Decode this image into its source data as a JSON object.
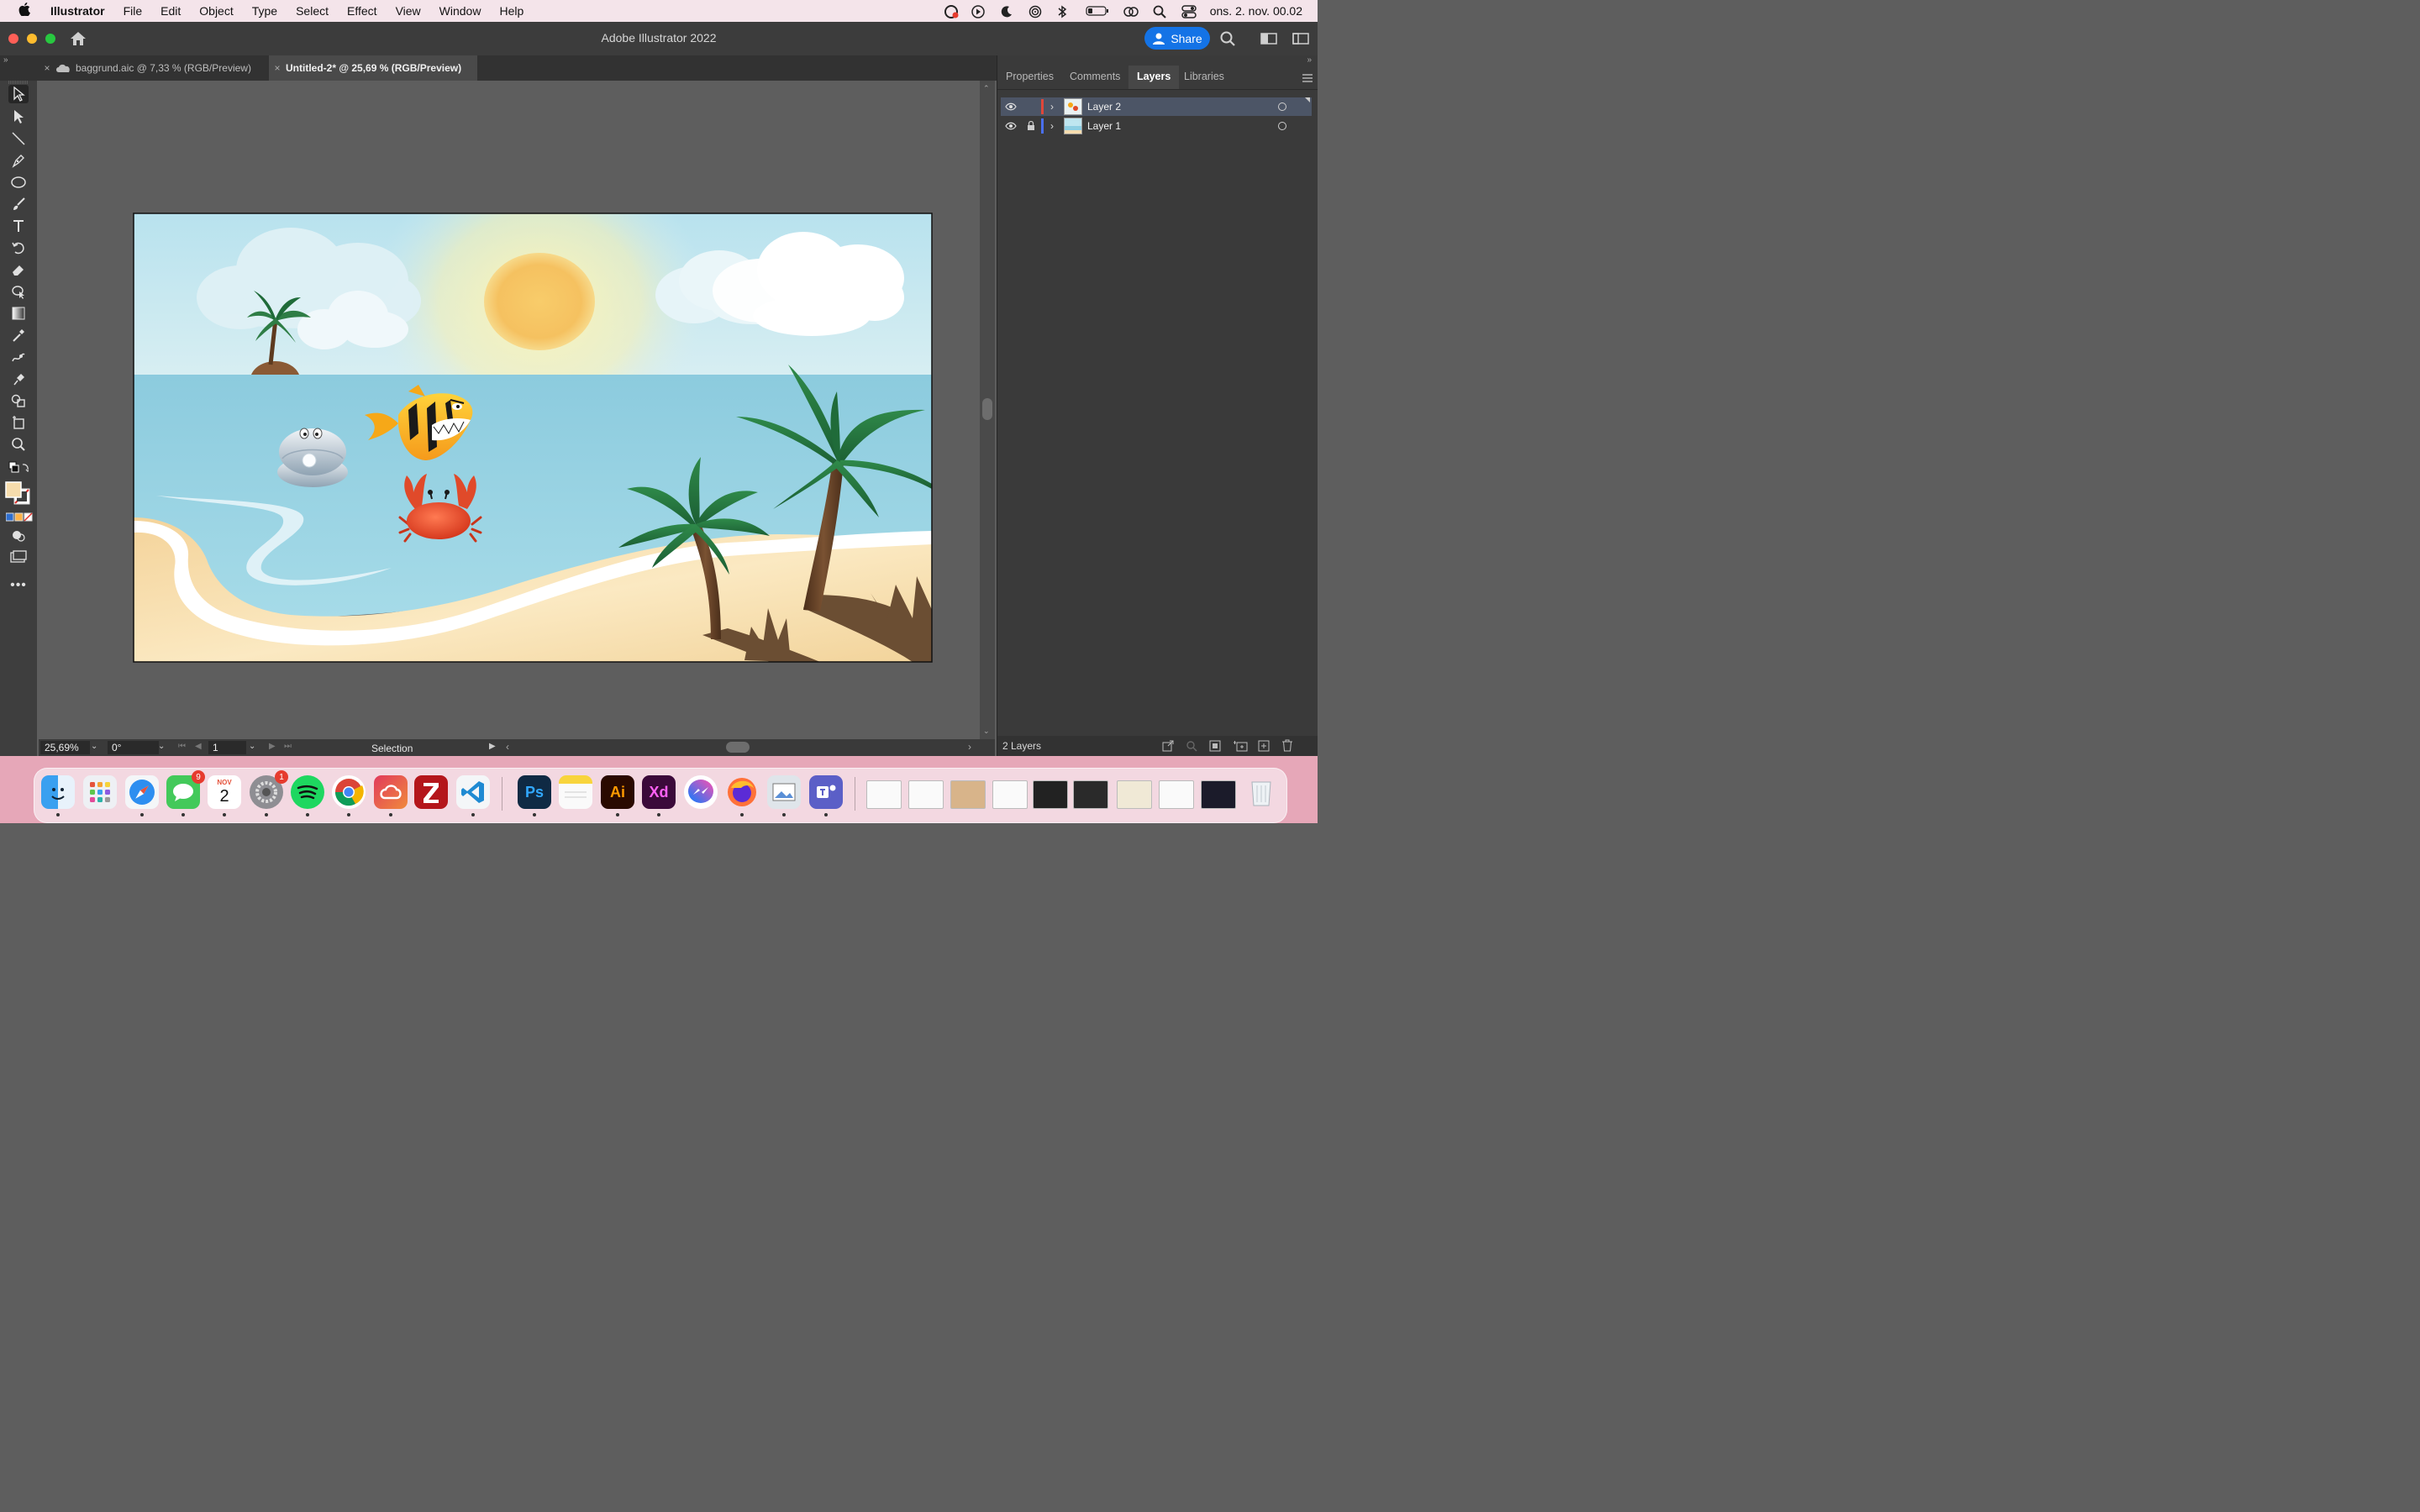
{
  "menubar": {
    "app": "Illustrator",
    "items": [
      "File",
      "Edit",
      "Object",
      "Type",
      "Select",
      "Effect",
      "View",
      "Window",
      "Help"
    ],
    "clock": "ons. 2. nov.  00.02"
  },
  "window": {
    "title": "Adobe Illustrator 2022",
    "share_label": "Share"
  },
  "tabs": [
    {
      "label": "baggrund.aic @ 7,33 % (RGB/Preview)",
      "active": false
    },
    {
      "label": "Untitled-2* @ 25,69 % (RGB/Preview)",
      "active": true
    }
  ],
  "statusbar": {
    "zoom": "25,69%",
    "rotation": "0°",
    "artboard": "1",
    "tool": "Selection"
  },
  "panel": {
    "tabs": [
      "Properties",
      "Comments",
      "Layers",
      "Libraries"
    ],
    "active_tab": "Layers",
    "layers": [
      {
        "name": "Layer 2",
        "color": "#e0473a",
        "locked": false,
        "selected": true
      },
      {
        "name": "Layer 1",
        "color": "#4a6ff0",
        "locked": true,
        "selected": false
      }
    ],
    "footer": "2 Layers"
  },
  "dock": {
    "badges": {
      "messages": "9",
      "calendar_month": "NOV",
      "calendar_day": "2",
      "settings": "1"
    },
    "app_labels": {
      "photoshop": "Ps",
      "illustrator": "Ai",
      "xd": "Xd"
    }
  },
  "colors": {
    "sky": "#bfe6f0",
    "sea": "#8ecfe3",
    "sand": "#f6ddb0",
    "sun": "#f3c15a",
    "accent": "#1473e6"
  }
}
